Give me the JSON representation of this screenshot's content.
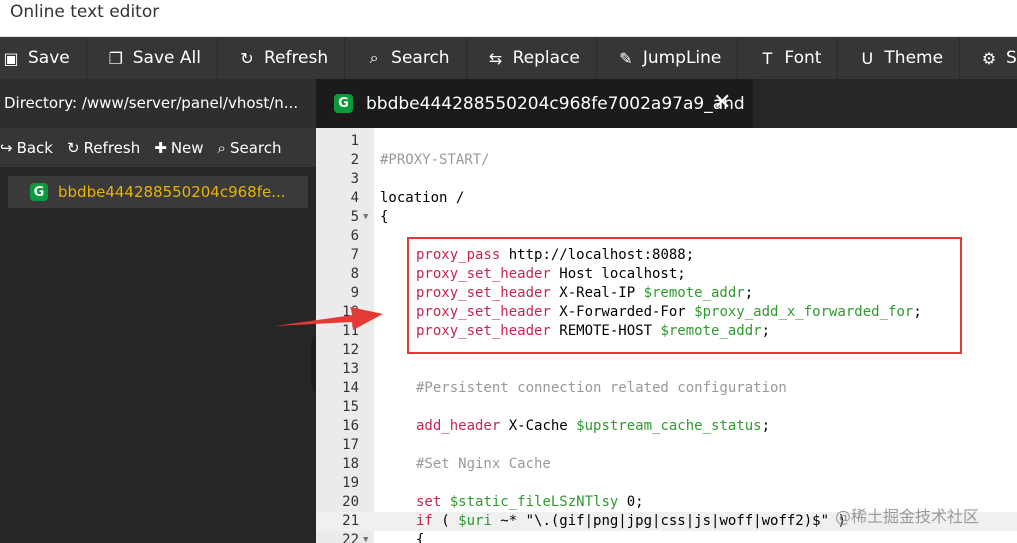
{
  "window": {
    "title": "Online text editor"
  },
  "toolbar": {
    "items": [
      {
        "label": "Save",
        "icon": "floppy-icon"
      },
      {
        "label": "Save All",
        "icon": "copy-icon"
      },
      {
        "label": "Refresh",
        "icon": "refresh-icon"
      },
      {
        "label": "Search",
        "icon": "search-icon"
      },
      {
        "label": "Replace",
        "icon": "replace-icon"
      },
      {
        "label": "JumpLine",
        "icon": "pin-icon"
      },
      {
        "label": "Font",
        "icon": "font-icon"
      },
      {
        "label": "Theme",
        "icon": "magnet-icon"
      },
      {
        "label": "Set",
        "icon": "gear-icon"
      }
    ]
  },
  "sidebar": {
    "directory": "Directory: /www/server/panel/vhost/n...",
    "actions": {
      "back": "Back",
      "refresh": "Refresh",
      "new": "New",
      "search": "Search"
    },
    "files": [
      {
        "name": "bbdbe444288550204c968fe..."
      }
    ]
  },
  "tab": {
    "title": "bbdbe444288550204c968fe7002a97a9_and"
  },
  "editor": {
    "lines": [
      {
        "n": "1",
        "text": ""
      },
      {
        "n": "2",
        "text": "#PROXY-START/"
      },
      {
        "n": "3",
        "text": ""
      },
      {
        "n": "4",
        "text": "location /"
      },
      {
        "n": "5",
        "text": "{"
      },
      {
        "n": "6",
        "text": ""
      },
      {
        "n": "7",
        "kw": "proxy_pass",
        "rest": " http://localhost:8088;"
      },
      {
        "n": "8",
        "kw": "proxy_set_header",
        "rest": " Host localhost;"
      },
      {
        "n": "9",
        "kw": "proxy_set_header",
        "rest": " X-Real-IP ",
        "var": "$remote_addr",
        "end": ";"
      },
      {
        "n": "10",
        "kw": "proxy_set_header",
        "rest": " X-Forwarded-For ",
        "var": "$proxy_add_x_forwarded_for",
        "end": ";"
      },
      {
        "n": "11",
        "kw": "proxy_set_header",
        "rest": " REMOTE-HOST ",
        "var": "$remote_addr",
        "end": ";"
      },
      {
        "n": "12",
        "text": ""
      },
      {
        "n": "13",
        "text": ""
      },
      {
        "n": "14",
        "comment": "#Persistent connection related configuration"
      },
      {
        "n": "15",
        "text": ""
      },
      {
        "n": "16",
        "kw": "add_header",
        "rest": " X-Cache ",
        "var": "$upstream_cache_status",
        "end": ";"
      },
      {
        "n": "17",
        "text": ""
      },
      {
        "n": "18",
        "comment": "#Set Nginx Cache"
      },
      {
        "n": "19",
        "text": ""
      },
      {
        "n": "20",
        "kw": "set",
        "rest": " ",
        "var": "$static_fileLSzNTlsy",
        "end": " 0;"
      },
      {
        "n": "21",
        "kw": "if",
        "rest": " ( ",
        "var": "$uri",
        "end": " ~* \"\\.(gif|png|jpg|css|js|woff|woff2)$\" )"
      },
      {
        "n": "22",
        "text": "{"
      }
    ]
  },
  "watermark": "@稀土掘金技术社区",
  "colors": {
    "keyword": "#c7254e",
    "variable": "#2f9a2f",
    "comment": "#999999",
    "annotation": "#e53935"
  }
}
